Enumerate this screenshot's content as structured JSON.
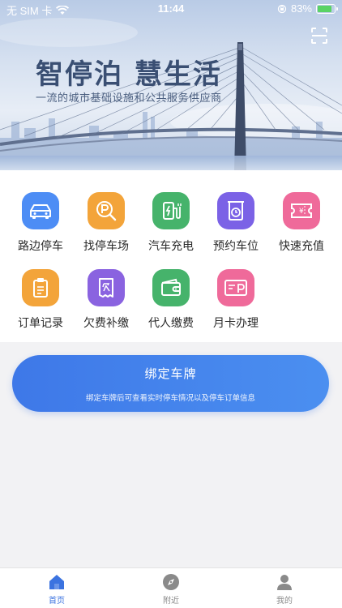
{
  "status_bar": {
    "carrier": "无 SIM 卡",
    "time": "11:44",
    "battery": "83%",
    "battery_level": 0.83
  },
  "hero": {
    "title": "智停泊 慧生活",
    "subtitle": "一流的城市基础设施和公共服务供应商",
    "scan_icon": "scan-icon"
  },
  "services": [
    {
      "label": "路边停车",
      "icon": "car-icon",
      "color": "#4d8df5"
    },
    {
      "label": "找停车场",
      "icon": "parking-search-icon",
      "color": "#f3a43a"
    },
    {
      "label": "汽车充电",
      "icon": "ev-charger-icon",
      "color": "#46b36b"
    },
    {
      "label": "预约车位",
      "icon": "reserve-clock-icon",
      "color": "#7b62e6"
    },
    {
      "label": "快速充值",
      "icon": "recharge-ticket-icon",
      "color": "#ef6a9a"
    },
    {
      "label": "订单记录",
      "icon": "clipboard-icon",
      "color": "#f3a43a"
    },
    {
      "label": "欠费补缴",
      "icon": "arrears-receipt-icon",
      "color": "#8a63e0"
    },
    {
      "label": "代人缴费",
      "icon": "wallet-icon",
      "color": "#46b36b"
    },
    {
      "label": "月卡办理",
      "icon": "monthly-card-icon",
      "color": "#ef6a9a"
    }
  ],
  "bind_card": {
    "title": "绑定车牌",
    "subtitle": "绑定车牌后可查看实时停车情况以及停车订单信息"
  },
  "tabbar": [
    {
      "label": "首页",
      "icon": "home-icon",
      "active": true
    },
    {
      "label": "附近",
      "icon": "compass-icon",
      "active": false
    },
    {
      "label": "我的",
      "icon": "profile-icon",
      "active": false
    }
  ],
  "colors": {
    "accent": "#3b73e0",
    "tab_inactive": "#8a8a8a"
  }
}
